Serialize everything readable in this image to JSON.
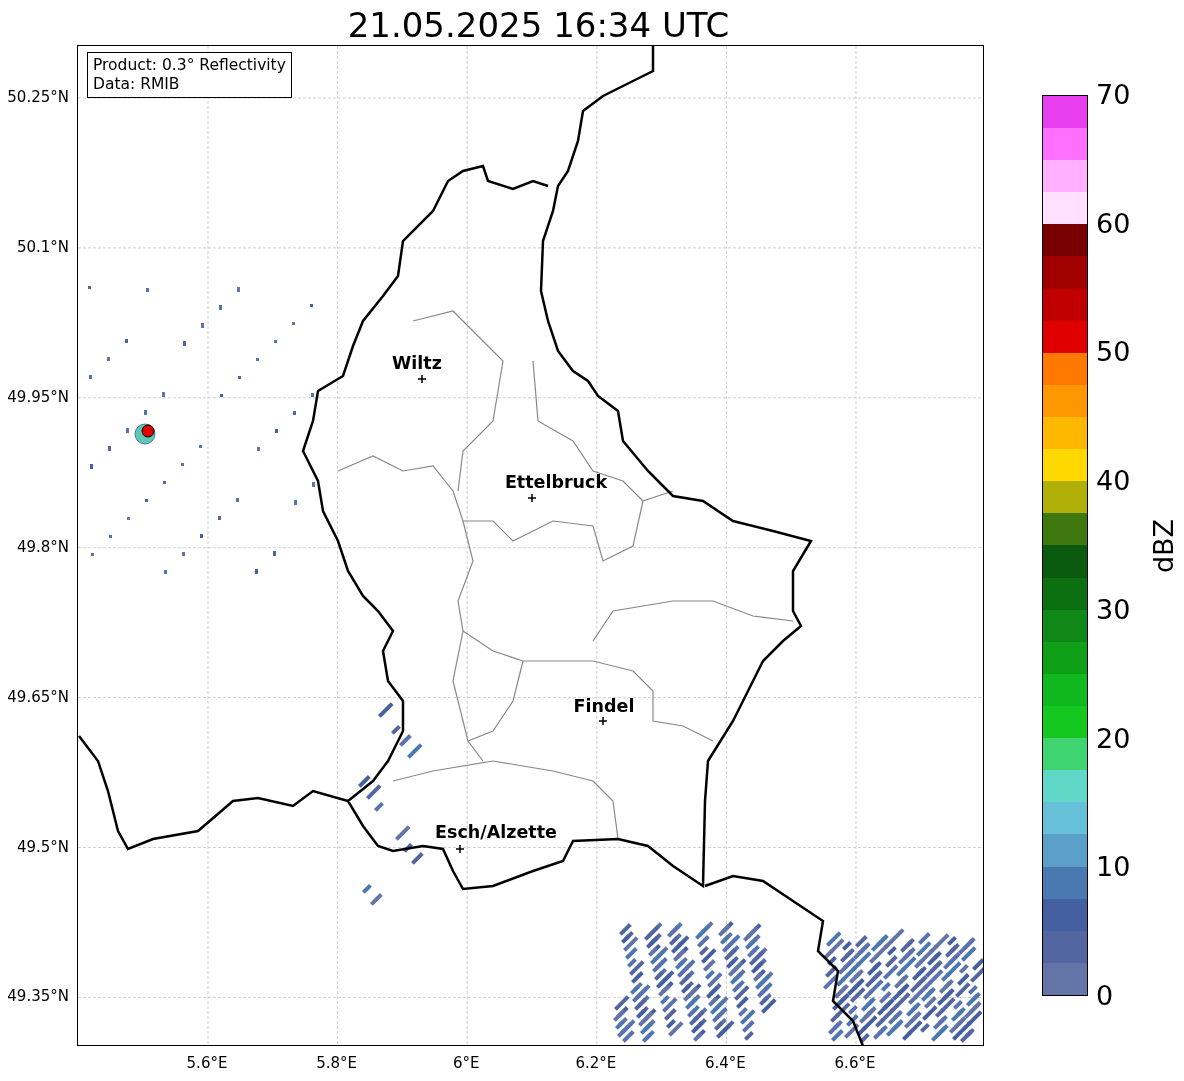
{
  "title": "21.05.2025 16:34 UTC",
  "info": [
    "Product: 0.3° Reflectivity",
    "Data: RMIB"
  ],
  "x_ticks": [
    "5.6°E",
    "5.8°E",
    "6°E",
    "6.2°E",
    "6.4°E",
    "6.6°E"
  ],
  "y_ticks": [
    "50.25°N",
    "50.1°N",
    "49.95°N",
    "49.8°N",
    "49.65°N",
    "49.5°N",
    "49.35°N"
  ],
  "cities": [
    {
      "name": "Wiltz"
    },
    {
      "name": "Ettelbruck"
    },
    {
      "name": "Findel"
    },
    {
      "name": "Esch/Alzette"
    }
  ],
  "colorbar": {
    "label": "dBZ",
    "ticks": [
      "70",
      "60",
      "50",
      "40",
      "30",
      "20",
      "10",
      "0"
    ],
    "segments": [
      {
        "color": "#6375a6"
      },
      {
        "color": "#5466a0"
      },
      {
        "color": "#4560a0"
      },
      {
        "color": "#4a78b0"
      },
      {
        "color": "#5aa0c8"
      },
      {
        "color": "#65c0d8"
      },
      {
        "color": "#60d8c8"
      },
      {
        "color": "#40d470"
      },
      {
        "color": "#14c820"
      },
      {
        "color": "#10b820"
      },
      {
        "color": "#10a018"
      },
      {
        "color": "#108818"
      },
      {
        "color": "#0c7010"
      },
      {
        "color": "#0a5a10"
      },
      {
        "color": "#407810"
      },
      {
        "color": "#b0b008"
      },
      {
        "color": "#ffd800"
      },
      {
        "color": "#ffb800"
      },
      {
        "color": "#ff9800"
      },
      {
        "color": "#ff7800"
      },
      {
        "color": "#e00000"
      },
      {
        "color": "#c00000"
      },
      {
        "color": "#a00000"
      },
      {
        "color": "#780000"
      },
      {
        "color": "#ffe0ff"
      },
      {
        "color": "#ffb0ff"
      },
      {
        "color": "#ff70ff"
      },
      {
        "color": "#e840f0"
      }
    ]
  }
}
